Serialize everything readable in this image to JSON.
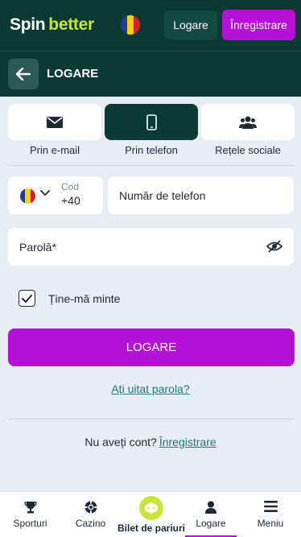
{
  "header": {
    "logo_spin": "Spin",
    "logo_better": "better",
    "login_label": "Logare",
    "register_label": "Înregistrare"
  },
  "subheader": {
    "title": "LOGARE"
  },
  "tabs": [
    {
      "label": "Prin e-mail",
      "icon": "envelope-icon",
      "active": false
    },
    {
      "label": "Prin telefon",
      "icon": "phone-icon",
      "active": true
    },
    {
      "label": "Rețele sociale",
      "icon": "users-icon",
      "active": false
    }
  ],
  "phone": {
    "code_caption": "Cod",
    "code_value": "+40",
    "number_placeholder": "Număr de telefon"
  },
  "password": {
    "placeholder": "Parolă*"
  },
  "remember": {
    "label": "Ține-mă minte",
    "checked": true
  },
  "login_button": "LOGARE",
  "forgot_link": "Ați uitat parola?",
  "no_account": {
    "text": "Nu aveți cont?",
    "link": "Înregistrare"
  },
  "bottom_nav": [
    {
      "label": "Sporturi",
      "icon": "trophy-icon"
    },
    {
      "label": "Cazino",
      "icon": "poker-chip-icon"
    },
    {
      "label": "Bilet de pariuri",
      "icon": "ticket-icon"
    },
    {
      "label": "Logare",
      "icon": "user-icon",
      "active": true
    },
    {
      "label": "Meniu",
      "icon": "menu-icon"
    }
  ],
  "colors": {
    "brand_dark": "#0b3a33",
    "accent_purple": "#b410d6",
    "accent_lime": "#c8e63c",
    "link_green": "#1e7a6c",
    "background": "#e8edf3"
  }
}
